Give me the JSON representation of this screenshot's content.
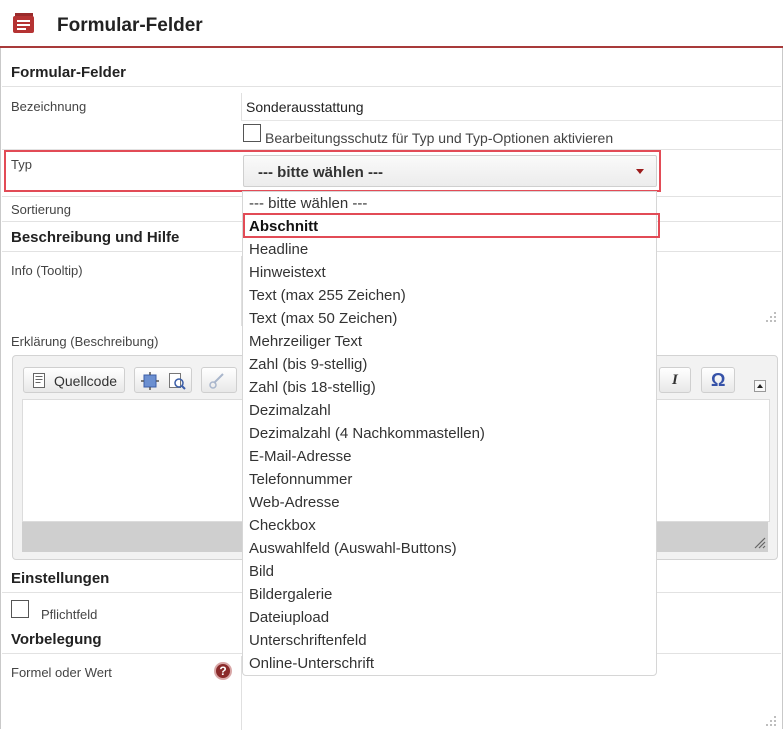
{
  "header": {
    "title": "Formular-Felder",
    "icon": "form-list-icon"
  },
  "sections": {
    "form_fields": "Formular-Felder",
    "description_help": "Beschreibung und Hilfe",
    "settings": "Einstellungen",
    "prefill": "Vorbelegung"
  },
  "fields": {
    "bezeichnung_label": "Bezeichnung",
    "bezeichnung_value": "Sonderausstattung",
    "protect_checkbox_label": "Bearbeitungsschutz für Typ und Typ-Optionen aktivieren",
    "typ_label": "Typ",
    "typ_selected": "--- bitte wählen ---",
    "sortierung_label": "Sortierung",
    "info_label": "Info (Tooltip)",
    "erklaerung_label": "Erklärung (Beschreibung)",
    "pflichtfeld_label": "Pflichtfeld",
    "formel_label": "Formel oder Wert"
  },
  "editor": {
    "source_button": "Quellcode",
    "italic_label": "I",
    "omega_label": "Ω"
  },
  "dropdown": {
    "selected_index": 1,
    "options": [
      "--- bitte wählen ---",
      "Abschnitt",
      "Headline",
      "Hinweistext",
      "Text (max 255 Zeichen)",
      "Text (max 50 Zeichen)",
      "Mehrzeiliger Text",
      "Zahl (bis 9-stellig)",
      "Zahl (bis 18-stellig)",
      "Dezimalzahl",
      "Dezimalzahl (4 Nachkommastellen)",
      "E-Mail-Adresse",
      "Telefonnummer",
      "Web-Adresse",
      "Checkbox",
      "Auswahlfeld (Auswahl-Buttons)",
      "Bild",
      "Bildergalerie",
      "Dateiupload",
      "Unterschriftenfeld",
      "Online-Unterschrift"
    ]
  },
  "help_icon": "?",
  "colors": {
    "accent": "#a83a3a",
    "highlight": "#e24b56"
  }
}
